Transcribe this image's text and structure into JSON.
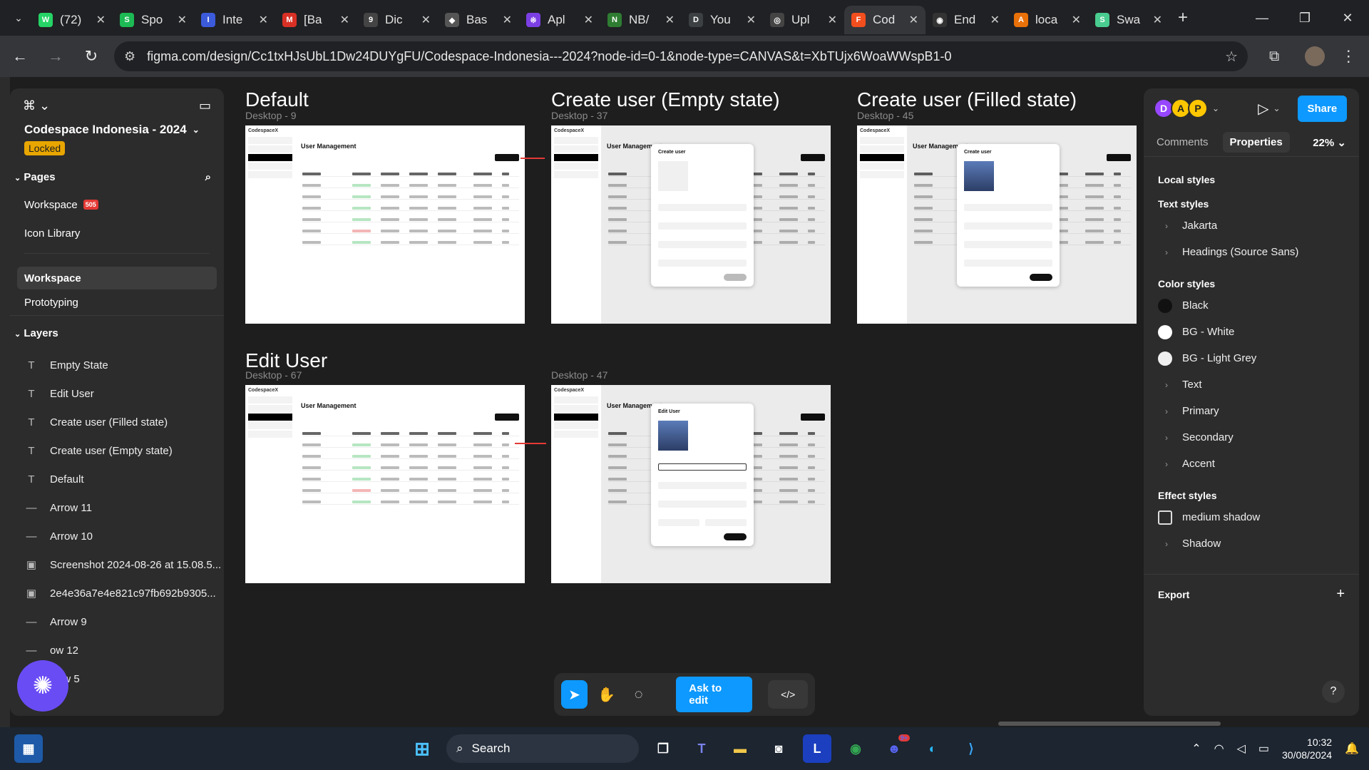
{
  "browser": {
    "tabs": [
      {
        "label": "(72)",
        "color": "#25d366",
        "glyph": "W",
        "active": false
      },
      {
        "label": "Spo",
        "color": "#1db954",
        "glyph": "S",
        "active": false
      },
      {
        "label": "Inte",
        "color": "#3b5bdb",
        "glyph": "I",
        "active": false
      },
      {
        "label": "[Ba",
        "color": "#d93025",
        "glyph": "M",
        "active": false
      },
      {
        "label": "Dic",
        "color": "#444444",
        "glyph": "9",
        "active": false
      },
      {
        "label": "Bas",
        "color": "#555555",
        "glyph": "◆",
        "active": false
      },
      {
        "label": "Apl",
        "color": "#7b3fe4",
        "glyph": "※",
        "active": false
      },
      {
        "label": "NB/",
        "color": "#2e7d32",
        "glyph": "N",
        "active": false
      },
      {
        "label": "You",
        "color": "#3c4043",
        "glyph": "D",
        "active": false
      },
      {
        "label": "Upl",
        "color": "#444444",
        "glyph": "◎",
        "active": false
      },
      {
        "label": "Cod",
        "color": "#f24e1e",
        "glyph": "F",
        "active": true
      },
      {
        "label": "End",
        "color": "#333333",
        "glyph": "◉",
        "active": false
      },
      {
        "label": "loca",
        "color": "#e8710a",
        "glyph": "A",
        "active": false
      },
      {
        "label": "Swa",
        "color": "#49cc90",
        "glyph": "S",
        "active": false
      }
    ],
    "url": "figma.com/design/Cc1txHJsUbL1Dw24DUYgFU/Codespace-Indonesia---2024?node-id=0-1&node-type=CANVAS&t=XbTUjx6WoaWWspB1-0"
  },
  "left_panel": {
    "project_name": "Codespace Indonesia - 2024",
    "locked_label": "Locked",
    "pages_label": "Pages",
    "pages": [
      {
        "label": "Workspace",
        "badge": "505"
      },
      {
        "label": "Icon Library",
        "badge": ""
      }
    ],
    "sections": [
      "Workspace",
      "Prototyping"
    ],
    "layers_label": "Layers",
    "layers": [
      {
        "icon": "T",
        "label": "Empty State"
      },
      {
        "icon": "T",
        "label": "Edit User"
      },
      {
        "icon": "T",
        "label": "Create user (Filled state)"
      },
      {
        "icon": "T",
        "label": "Create user (Empty state)"
      },
      {
        "icon": "T",
        "label": "Default"
      },
      {
        "icon": "—",
        "label": "Arrow 11"
      },
      {
        "icon": "—",
        "label": "Arrow 10"
      },
      {
        "icon": "▣",
        "label": "Screenshot 2024-08-26 at 15.08.5..."
      },
      {
        "icon": "▣",
        "label": "2e4e36a7e4e821c97fb692b9305..."
      },
      {
        "icon": "—",
        "label": "Arrow 9"
      },
      {
        "icon": "—",
        "label": "ow 12"
      },
      {
        "icon": "—",
        "label": "rrow 5"
      }
    ]
  },
  "canvas": {
    "frames": [
      {
        "title": "Default",
        "sub": "Desktop - 9"
      },
      {
        "title": "Create user (Empty state)",
        "sub": "Desktop - 37"
      },
      {
        "title": "Create user (Filled state)",
        "sub": "Desktop - 45"
      },
      {
        "title": "Edit User",
        "sub": "Desktop - 67"
      },
      {
        "title": "",
        "sub": "Desktop - 47"
      }
    ],
    "mini": {
      "logo": "CodespaceX",
      "heading": "User Management",
      "create_title": "Create user",
      "edit_title": "Edit User"
    }
  },
  "toolbar": {
    "ask_label": "Ask to edit",
    "code_label": "</>"
  },
  "right_panel": {
    "avatars": [
      {
        "letter": "D",
        "color": "#9747ff"
      },
      {
        "letter": "A",
        "color": "#ffc700"
      },
      {
        "letter": "P",
        "color": "#ffc700"
      }
    ],
    "share_label": "Share",
    "tabs": [
      "Comments",
      "Properties"
    ],
    "zoom": "22%",
    "local_styles": "Local styles",
    "text_styles_label": "Text styles",
    "text_styles": [
      "Jakarta",
      "Headings (Source Sans)"
    ],
    "color_styles_label": "Color styles",
    "color_styles": [
      {
        "label": "Black",
        "swatch": "#111111",
        "group": false
      },
      {
        "label": "BG - White",
        "swatch": "#ffffff",
        "group": false
      },
      {
        "label": "BG - Light Grey",
        "swatch": "#f0f0f0",
        "group": false
      },
      {
        "label": "Text",
        "swatch": "",
        "group": true
      },
      {
        "label": "Primary",
        "swatch": "",
        "group": true
      },
      {
        "label": "Secondary",
        "swatch": "",
        "group": true
      },
      {
        "label": "Accent",
        "swatch": "",
        "group": true
      }
    ],
    "effect_styles_label": "Effect styles",
    "effect_styles": [
      {
        "label": "medium shadow",
        "group": false
      },
      {
        "label": "Shadow",
        "group": true
      }
    ],
    "export_label": "Export"
  },
  "taskbar": {
    "search_label": "Search",
    "time": "10:32",
    "date": "30/08/2024",
    "discord_badge": "9+"
  }
}
